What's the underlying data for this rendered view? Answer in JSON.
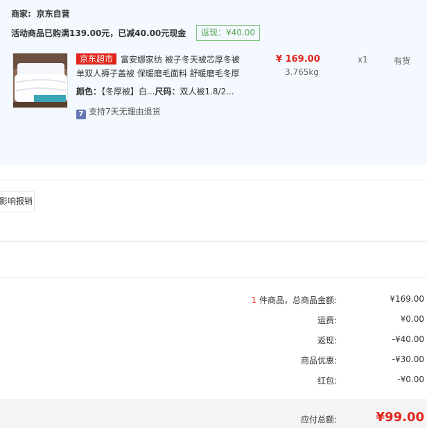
{
  "merchant": {
    "label": "商家:",
    "name": "京东自营"
  },
  "promo": {
    "text": "活动商品已购满139.00元，已减40.00元现金",
    "rebate_badge": "返现：¥40.00"
  },
  "product": {
    "tag": "京东超市",
    "title": "富安娜家纺 被子冬天被芯厚冬被单双人褥子盖被 保暖磨毛面料 舒暖磨毛冬厚",
    "price": "¥ 169.00",
    "weight": "3.765kg",
    "quantity": "x1",
    "stock": "有货",
    "color_label": "颜色：",
    "color_value": "【冬厚被】白...",
    "size_label": "尺码：",
    "size_value": "双人被1.8/2...",
    "return_policy_icon": "7",
    "return_policy": "支持7天无理由退货"
  },
  "invoice_button": "影响报销",
  "summary": {
    "count": "1",
    "goods_label": " 件商品，总商品金额:",
    "goods_value": "¥169.00",
    "shipping_label": "运费:",
    "shipping_value": "¥0.00",
    "rebate_label": "返现:",
    "rebate_value": "-¥40.00",
    "discount_label": "商品优惠:",
    "discount_value": "-¥30.00",
    "redpacket_label": "红包:",
    "redpacket_value": "-¥0.00",
    "total_label": "应付总额:",
    "total_value": "¥99.00"
  },
  "colors": {
    "accent_red": "#e1251b",
    "rebate_green": "#5aa85a",
    "panel_bg": "#f3f9fe"
  }
}
